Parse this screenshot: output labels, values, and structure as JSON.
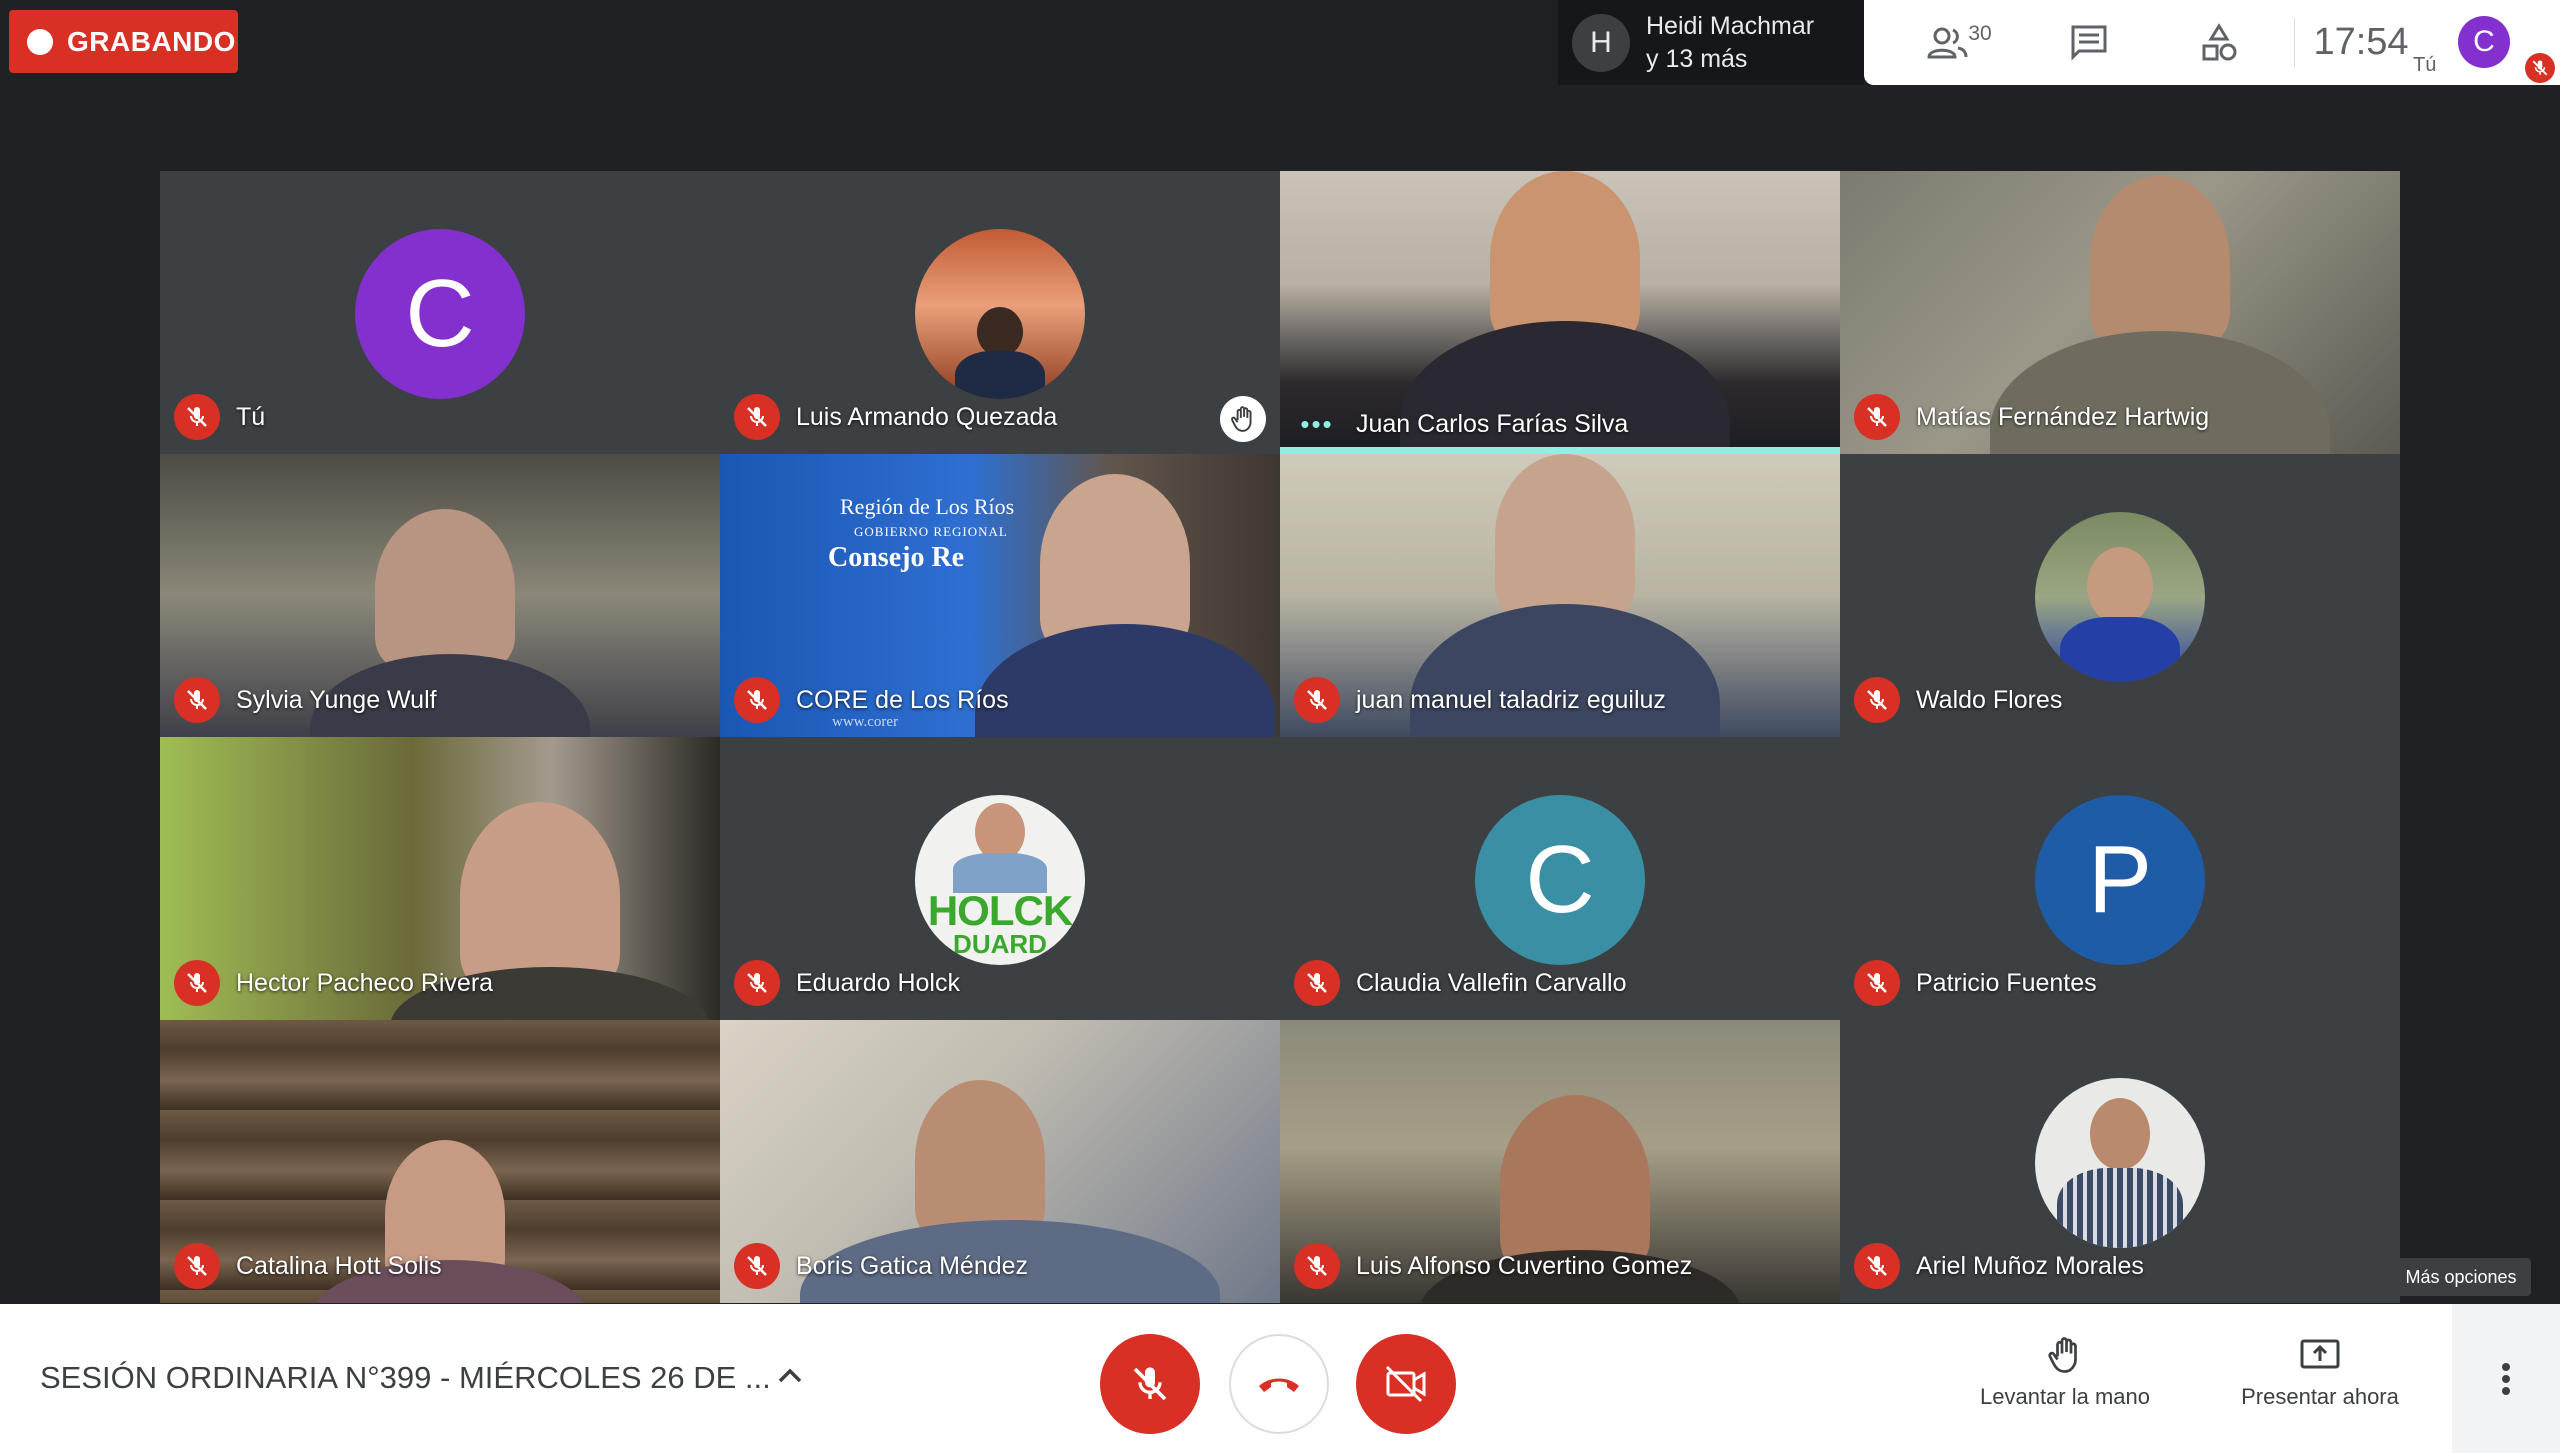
{
  "recording": {
    "label": "GRABANDO"
  },
  "presenter": {
    "initial": "H",
    "line1": "Heidi Machmar",
    "line2": "y 13 más"
  },
  "top_panel": {
    "people_count": "30",
    "clock": "17:54",
    "self_initial": "C",
    "self_label": "Tú"
  },
  "participants": [
    {
      "name": "Tú",
      "initial": "C",
      "avatar_color": "#8430ce",
      "muted": true
    },
    {
      "name": "Luis Armando Quezada",
      "muted": true,
      "hand_raised": true
    },
    {
      "name": "Juan Carlos Farías Silva",
      "speaking": true
    },
    {
      "name": "Matías Fernández Hartwig",
      "muted": true
    },
    {
      "name": "Sylvia Yunge Wulf",
      "muted": true
    },
    {
      "name": "CORE de Los Ríos",
      "muted": true,
      "sign": "Región de Los Ríos",
      "sign2": "GOBIERNO REGIONAL",
      "sign3": "Consejo Re",
      "sign4": "www.corer"
    },
    {
      "name": "juan manuel taladriz eguiluz",
      "muted": true
    },
    {
      "name": "Waldo Flores",
      "muted": true
    },
    {
      "name": "Hector Pacheco Rivera",
      "muted": true
    },
    {
      "name": "Eduardo Holck",
      "muted": true,
      "avatar_text": "HOLCK",
      "avatar_text2": "DUARD"
    },
    {
      "name": "Claudia Vallefin Carvallo",
      "initial": "C",
      "avatar_color": "#3b8fa5",
      "muted": true
    },
    {
      "name": "Patricio Fuentes",
      "initial": "P",
      "avatar_color": "#1f5ca8",
      "muted": true
    },
    {
      "name": "Catalina Hott Solis",
      "muted": true
    },
    {
      "name": "Boris Gatica Méndez",
      "muted": true
    },
    {
      "name": "Luis Alfonso Cuvertino Gomez",
      "muted": true
    },
    {
      "name": "Ariel Muñoz Morales",
      "muted": true
    }
  ],
  "tooltip": "Más opciones",
  "bottom_bar": {
    "meeting_title": "SESIÓN ORDINARIA N°399 - MIÉRCOLES 26 DE ...",
    "raise_hand_label": "Levantar la mano",
    "present_label": "Presentar ahora"
  },
  "colors": {
    "accent_red": "#d93025",
    "speaking": "#8ef0e0",
    "background": "#202124"
  }
}
